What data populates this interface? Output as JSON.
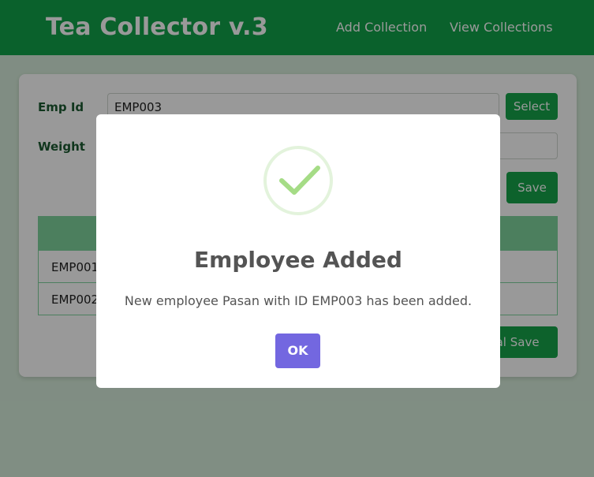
{
  "navbar": {
    "brand": "Tea Collector v.3",
    "links": [
      "Add Collection",
      "View Collections"
    ]
  },
  "form": {
    "emp_label": "Emp Id",
    "emp_value": "EMP003",
    "weight_label": "Weight",
    "weight_value": "",
    "select_label": "Select",
    "save_label": "Save",
    "final_save_label": "Final Save"
  },
  "table": {
    "rows": [
      "EMP001",
      "EMP002"
    ]
  },
  "modal": {
    "icon": "check-icon",
    "title": "Employee Added",
    "message": "New employee Pasan with ID EMP003 has been added.",
    "ok_label": "OK"
  },
  "colors": {
    "primary": "#12a24a",
    "confirm_button": "#7367e0",
    "check": "#a5dc86"
  }
}
